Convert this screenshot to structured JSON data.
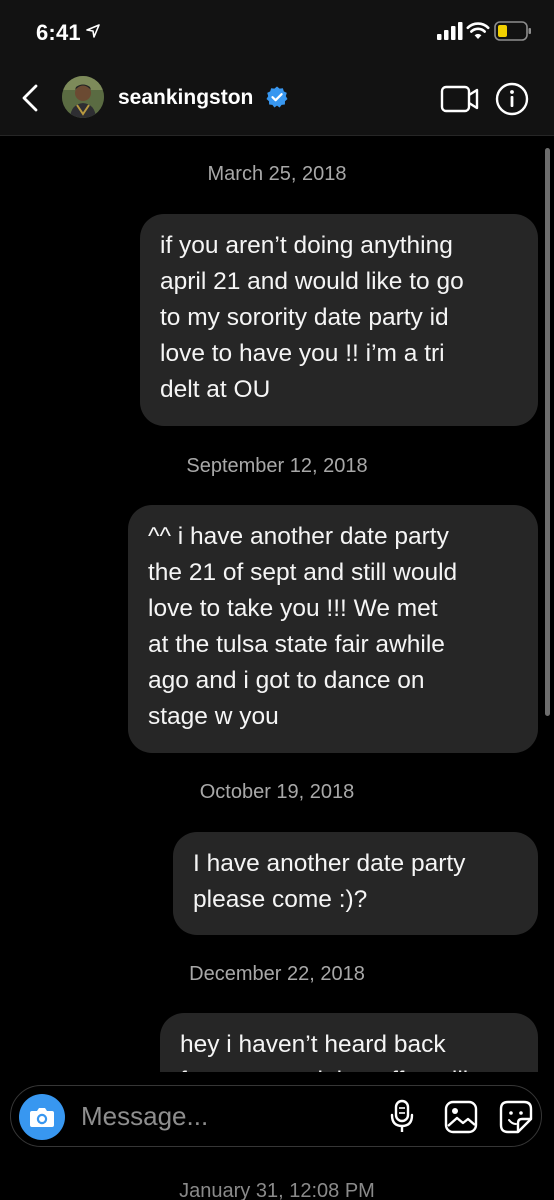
{
  "status_bar": {
    "time": "6:41"
  },
  "header": {
    "username": "seankingston",
    "verified": true
  },
  "messages": [
    {
      "date": "March 25, 2018",
      "text": "if you aren’t doing anything\napril 21 and would like to go\nto my sorority date party id\nlove to have you !! i’m a tri\ndelt at OU"
    },
    {
      "date": "September 12, 2018",
      "text": "^^ i have another date party\nthe 21 of sept and still would\nlove to take you !!! We met\nat the tulsa state fair awhile\nago and i got to dance on\nstage w you"
    },
    {
      "date": "October 19, 2018",
      "text": "I have another date party\nplease come :)?"
    },
    {
      "date": "December 22, 2018",
      "text": "hey i haven’t heard back\nfrom you and that offer still"
    }
  ],
  "composer": {
    "placeholder": "Message..."
  },
  "bottom_timestamp": "January 31, 12:08 PM",
  "colors": {
    "background": "#000000",
    "bubble": "#262626",
    "accent": "#3897f0",
    "verified": "#3897f0"
  },
  "icons": [
    "location-arrow-icon",
    "signal-icon",
    "wifi-icon",
    "battery-icon",
    "back-chevron-icon",
    "verified-badge-icon",
    "video-camera-icon",
    "info-icon",
    "camera-icon",
    "microphone-icon",
    "gallery-icon",
    "sticker-icon"
  ]
}
